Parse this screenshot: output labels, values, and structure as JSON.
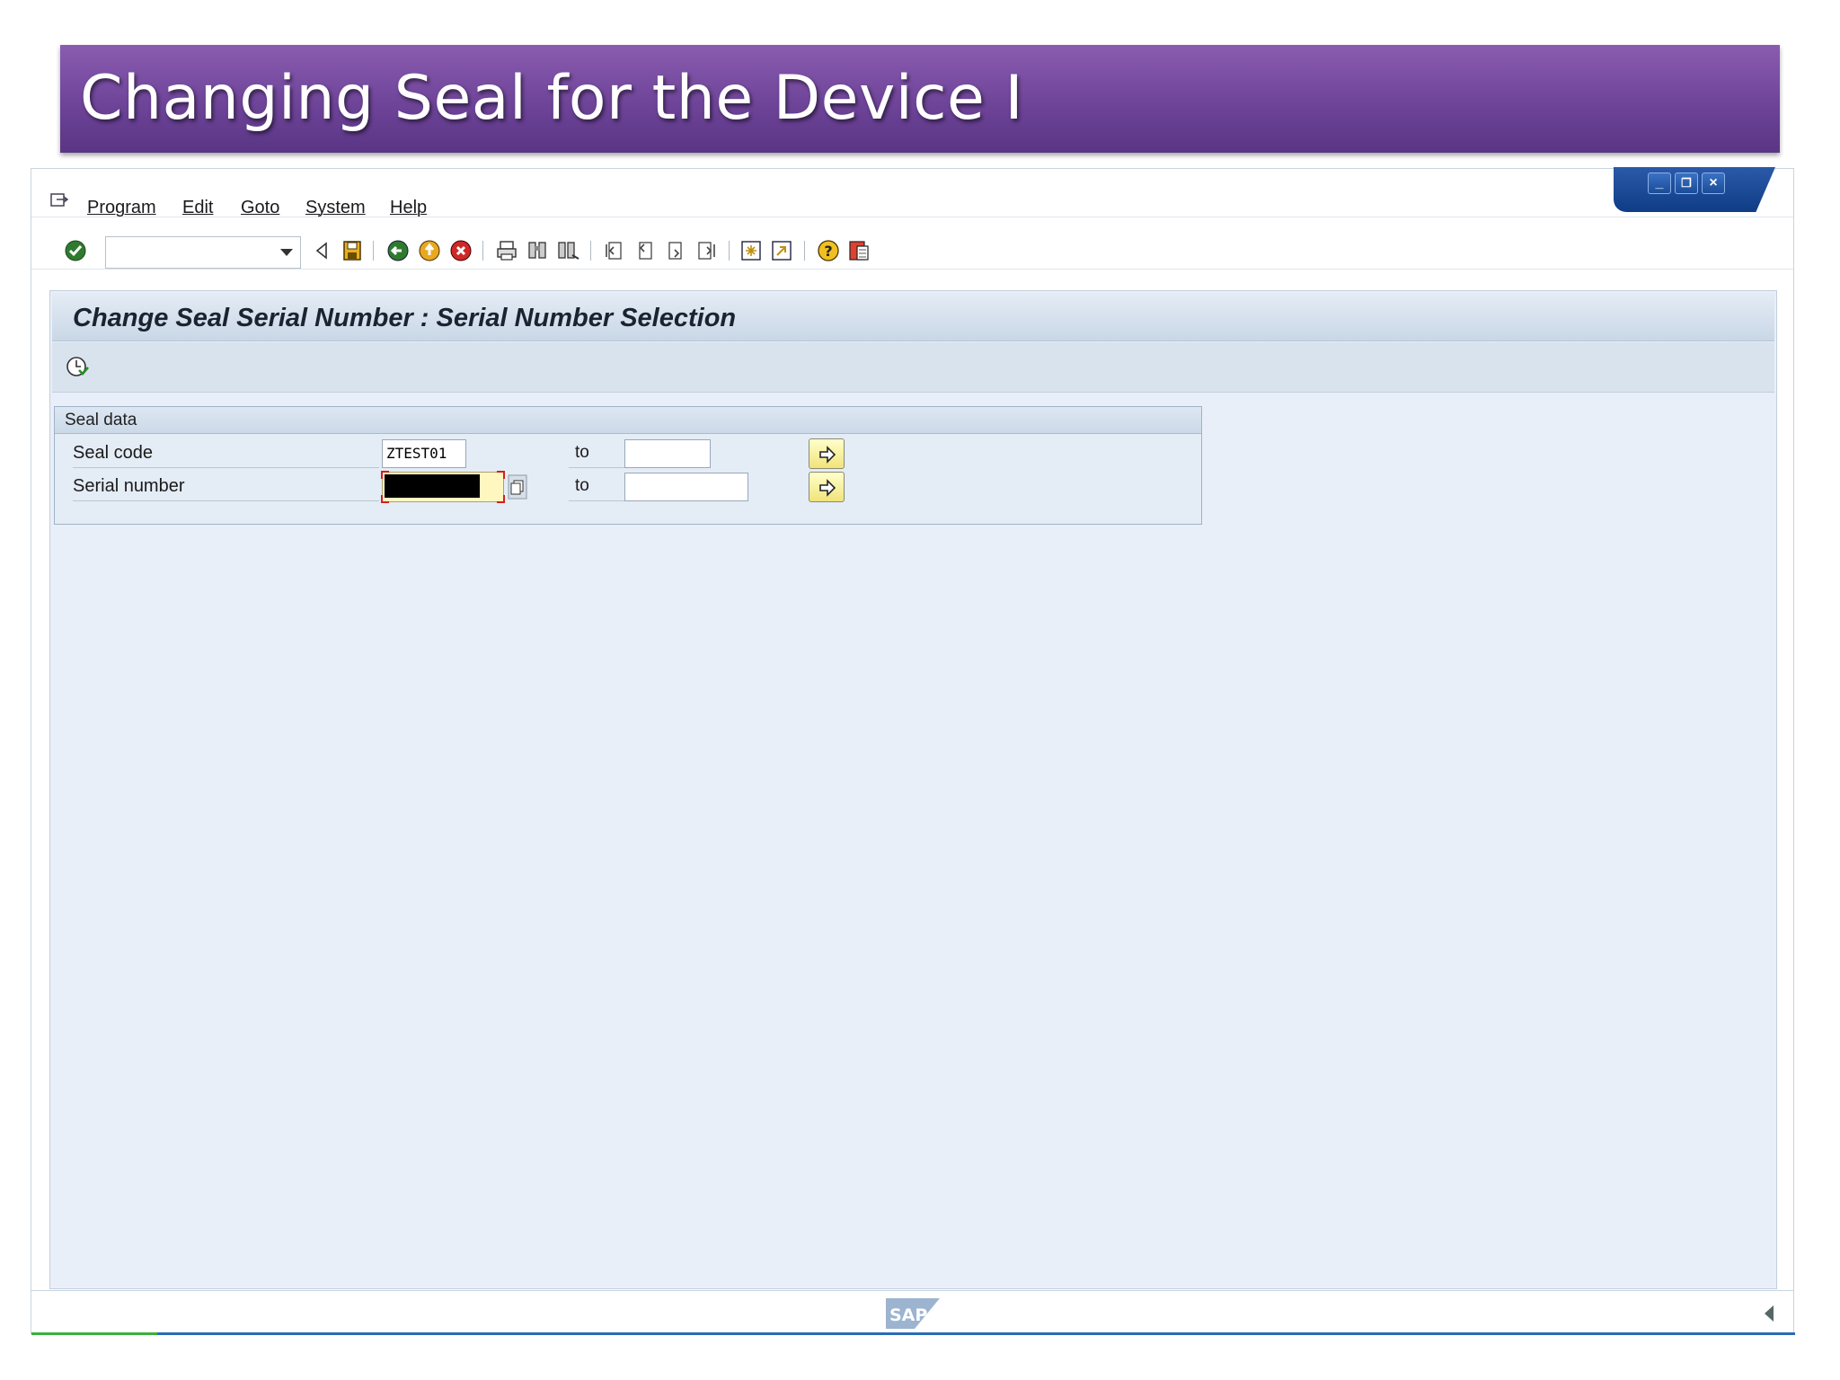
{
  "slide": {
    "title": "Changing Seal for the Device I"
  },
  "menu": [
    {
      "label": "Program"
    },
    {
      "label": "Edit"
    },
    {
      "label": "Goto"
    },
    {
      "label": "System"
    },
    {
      "label": "Help"
    }
  ],
  "toolbar": {
    "command_field": {
      "value": ""
    },
    "icons": [
      "enter-icon",
      "back-icon",
      "save-icon",
      "back-green-icon",
      "exit-icon",
      "cancel-icon",
      "print-icon",
      "find-icon",
      "find-next-icon",
      "first-page-icon",
      "previous-page-icon",
      "next-page-icon",
      "last-page-icon",
      "create-session-icon",
      "shortcut-icon",
      "help-icon",
      "layout-icon"
    ]
  },
  "screen": {
    "title": "Change Seal Serial Number : Serial Number Selection",
    "group": {
      "title": "Seal data",
      "rows": [
        {
          "label": "Seal code",
          "from": "ZTEST01",
          "to_label": "to",
          "to": ""
        },
        {
          "label": "Serial number",
          "from": "",
          "to_label": "to",
          "to": ""
        }
      ]
    }
  },
  "status": {
    "logo": "SAP"
  },
  "colors": {
    "banner": "#6e4499",
    "content_bg": "#e9eff8",
    "window_controls": "#1a4c98",
    "focus_field": "#fff6c0"
  }
}
